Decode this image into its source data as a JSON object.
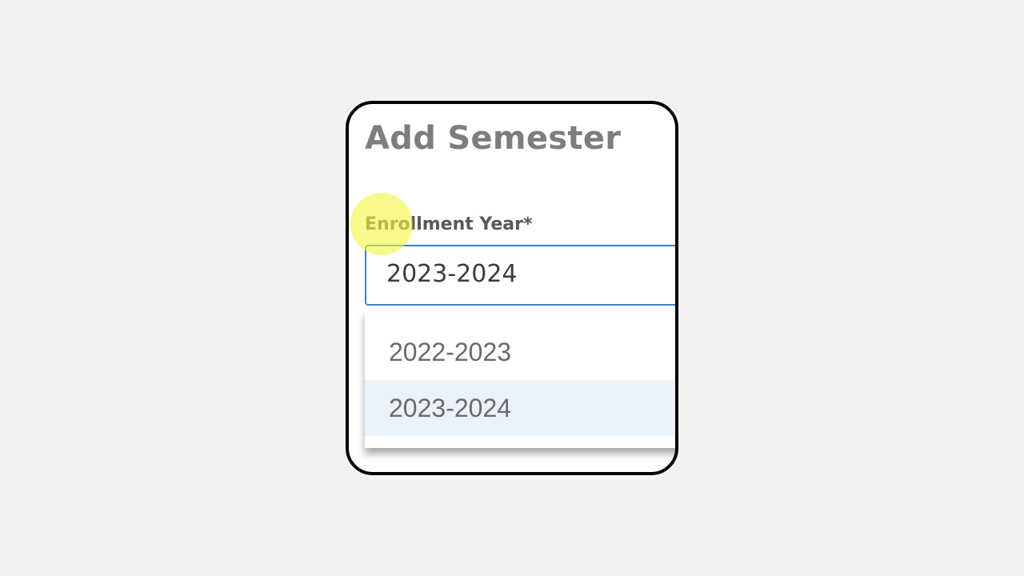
{
  "dialog": {
    "title": "Add Semester"
  },
  "enrollment_year": {
    "label": "Enrollment Year*",
    "selected_value": "2023-2024",
    "options": [
      {
        "label": "2022-2023",
        "highlighted": false
      },
      {
        "label": "2023-2024",
        "highlighted": true
      }
    ]
  },
  "colors": {
    "background": "#f2f2f2",
    "frame_border": "#000000",
    "title_text": "#7d7d7d",
    "label_text": "#585858",
    "select_border": "#3b80cf",
    "option_highlight": "#ebf2fa",
    "click_highlight": "#f6f640"
  }
}
